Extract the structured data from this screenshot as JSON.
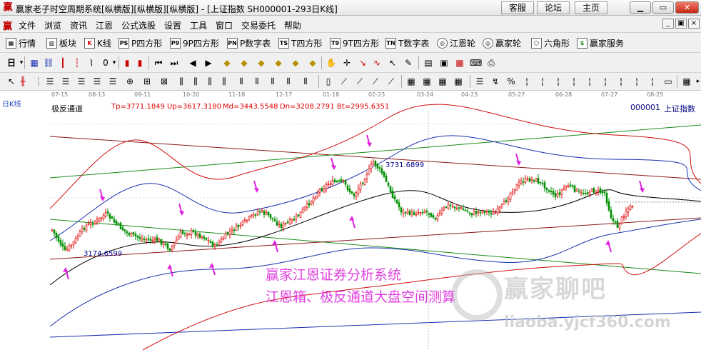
{
  "titlebar": {
    "icon": "赢",
    "title": "赢家老子时空周期系统[纵横版][纵横版][纵横版] - [上证指数  SH000001-293日K线]",
    "links": [
      "客服",
      "论坛",
      "主页"
    ]
  },
  "menubar": {
    "icon": "赢",
    "items": [
      "文件",
      "浏览",
      "资讯",
      "江恩",
      "公式选股",
      "设置",
      "工具",
      "窗口",
      "交易委托",
      "帮助"
    ],
    "mdi_min": "_",
    "mdi_restore": "▣",
    "mdi_close": "×"
  },
  "toolbar1": {
    "items": [
      {
        "icon": "▦",
        "label": "行情"
      },
      {
        "icon": "▥",
        "label": "板块"
      },
      {
        "icon": "K",
        "label": "K线"
      },
      {
        "icon": "PS",
        "label": "P四方形"
      },
      {
        "icon": "P9",
        "label": "9P四方形"
      },
      {
        "icon": "PN",
        "label": "P数字表"
      },
      {
        "icon": "TS",
        "label": "T四方形"
      },
      {
        "icon": "T9",
        "label": "9T四方形"
      },
      {
        "icon": "TN",
        "label": "T数字表"
      },
      {
        "icon": "◎",
        "label": "江恩轮"
      },
      {
        "icon": "◎",
        "label": "赢家轮"
      },
      {
        "icon": "⬡",
        "label": "六角形"
      },
      {
        "icon": "$",
        "label": "赢家服务"
      }
    ]
  },
  "chart": {
    "dates": [
      "07-15",
      "08-13",
      "09-11",
      "10-20",
      "11-18",
      "12-17",
      "01-18",
      "02-23",
      "03-24",
      "04-23",
      "05-27",
      "06-28",
      "07-27",
      "08-25"
    ],
    "period_tag": "日K线",
    "indicator_name": "极反通道",
    "values": {
      "tp": "Tp=3771.1849",
      "up": "Up=3617.3180",
      "md": "Md=3443.5548",
      "dn": "Dn=3208.2791",
      "bt": "Bt=2995.6351"
    },
    "symbol_code": "000001",
    "symbol_name": "上证指数",
    "high_label": "3731.6899",
    "low_label": "3174.6599",
    "promo_line1": "赢家江恩证券分析系统",
    "promo_line2": "江恩箱、极反通道大盘空间测算",
    "watermark_text": "赢家聊吧",
    "watermark_url": "liaoba.yjcf360.com",
    "colors": {
      "up": "#e00000",
      "down": "#009000",
      "mid_line": "#000000",
      "channel_blue": "#1a30b0",
      "channel_red": "#d01010",
      "trend_green": "#1a8a1a",
      "trend_brown": "#8b1a1a",
      "arrow": "#e020e0"
    }
  }
}
